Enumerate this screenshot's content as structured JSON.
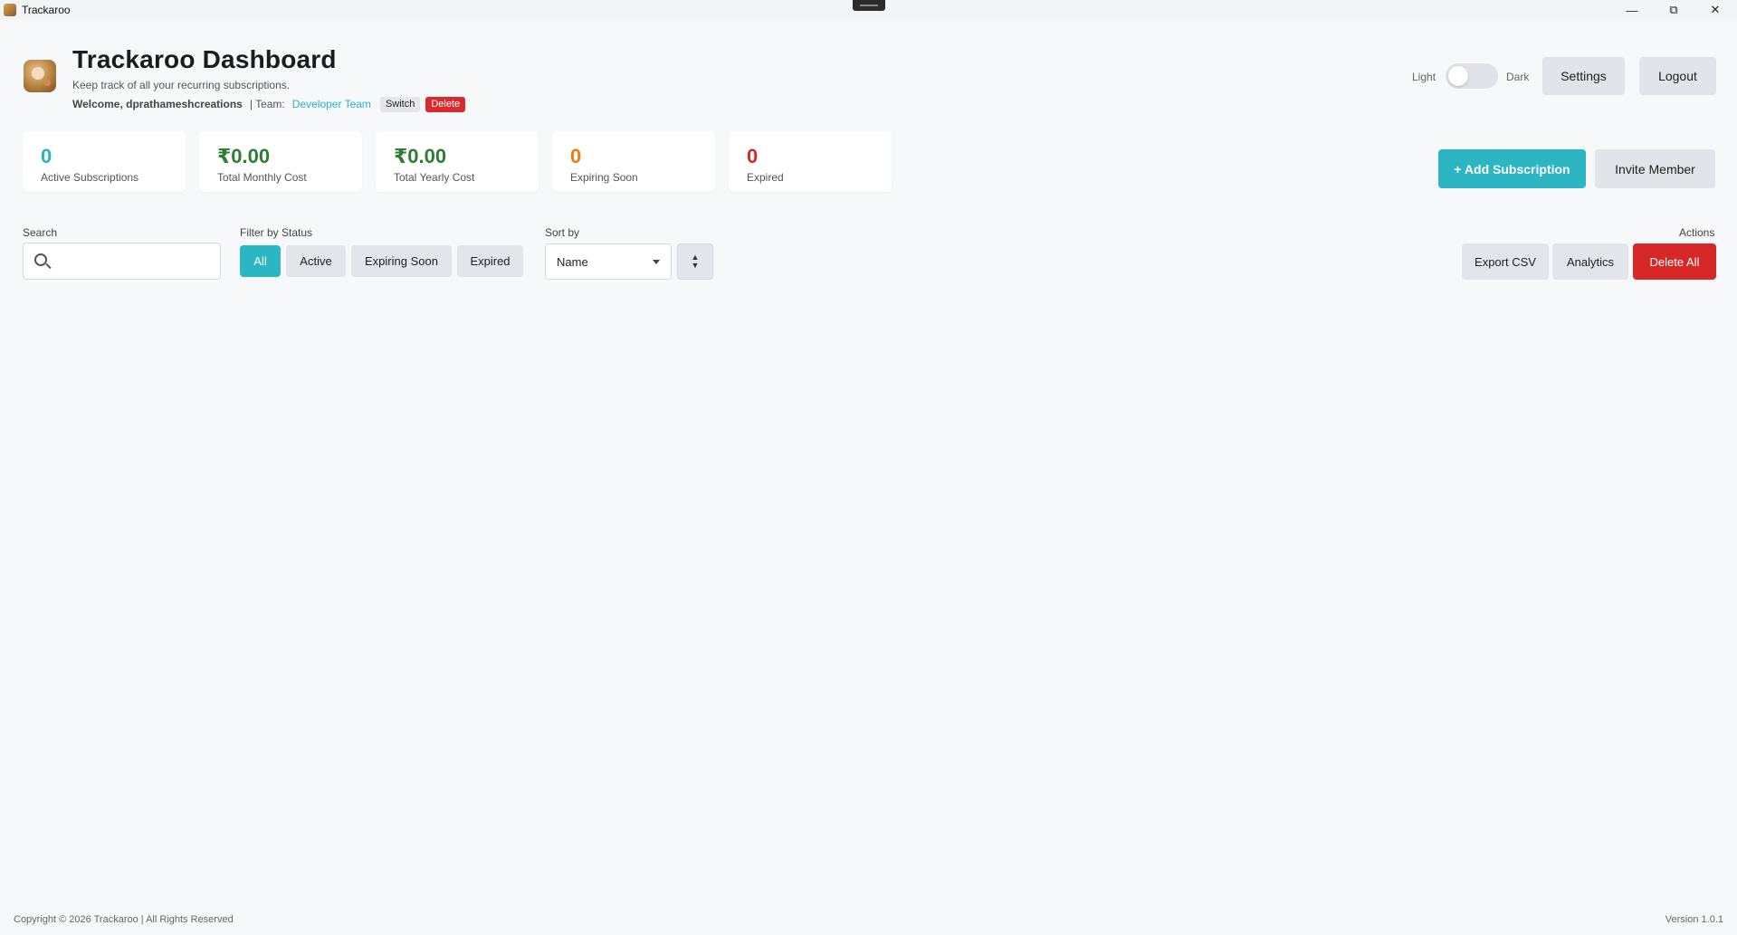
{
  "window": {
    "title": "Trackaroo"
  },
  "header": {
    "title": "Trackaroo Dashboard",
    "subtitle": "Keep track of all your recurring subscriptions.",
    "welcome": "Welcome, dprathameshcreations",
    "team_label": "| Team:",
    "team_name": "Developer Team",
    "switch_label": "Switch",
    "delete_label": "Delete"
  },
  "theme": {
    "light_label": "Light",
    "dark_label": "Dark",
    "is_dark": false
  },
  "top_buttons": {
    "settings": "Settings",
    "logout": "Logout"
  },
  "stats": [
    {
      "value": "0",
      "label": "Active Subscriptions",
      "color": "#2bb3c0"
    },
    {
      "value": "₹0.00",
      "label": "Total Monthly Cost",
      "color": "#2e7d32"
    },
    {
      "value": "₹0.00",
      "label": "Total Yearly Cost",
      "color": "#2e7d32"
    },
    {
      "value": "0",
      "label": "Expiring Soon",
      "color": "#ef7d0c"
    },
    {
      "value": "0",
      "label": "Expired",
      "color": "#d62828"
    }
  ],
  "primary_actions": {
    "add": "+ Add Subscription",
    "invite": "Invite Member"
  },
  "filters": {
    "search_label": "Search",
    "search_value": "",
    "search_placeholder": "",
    "status_label": "Filter by Status",
    "status_options": [
      "All",
      "Active",
      "Expiring Soon",
      "Expired"
    ],
    "status_selected": "All",
    "sort_label": "Sort by",
    "sort_value": "Name"
  },
  "actions": {
    "label": "Actions",
    "export": "Export CSV",
    "analytics": "Analytics",
    "delete_all": "Delete All"
  },
  "footer": {
    "copyright": "Copyright © 2026 Trackaroo | All Rights Reserved",
    "version": "Version 1.0.1"
  }
}
